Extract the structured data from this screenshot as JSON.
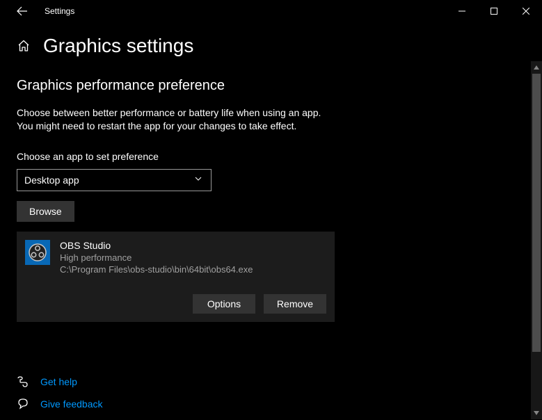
{
  "window": {
    "title": "Settings"
  },
  "page": {
    "title": "Graphics settings",
    "section_title": "Graphics performance preference",
    "description_line1": "Choose between better performance or battery life when using an app.",
    "description_line2": "You might need to restart the app for your changes to take effect.",
    "field_label": "Choose an app to set preference",
    "dropdown_value": "Desktop app",
    "browse_label": "Browse"
  },
  "app": {
    "name": "OBS Studio",
    "performance": "High performance",
    "path": "C:\\Program Files\\obs-studio\\bin\\64bit\\obs64.exe",
    "options_label": "Options",
    "remove_label": "Remove"
  },
  "footer": {
    "help": "Get help",
    "feedback": "Give feedback"
  }
}
